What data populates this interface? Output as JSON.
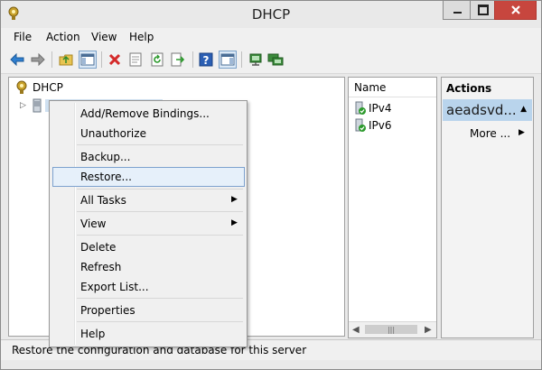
{
  "window": {
    "title": "DHCP",
    "controls": {
      "minimize_icon": "minimize-icon",
      "maximize_icon": "maximize-icon",
      "close_icon": "close-icon"
    }
  },
  "menubar": {
    "items": [
      "File",
      "Action",
      "View",
      "Help"
    ]
  },
  "toolbar": {
    "buttons": [
      "back-arrow-icon",
      "forward-arrow-icon",
      "up-folder-icon",
      "show-hide-tree-icon",
      "delete-icon",
      "properties-icon",
      "refresh-icon",
      "export-icon",
      "help-icon",
      "show-hide-action-pane-icon",
      "server-icon",
      "server-authorize-icon"
    ]
  },
  "tree": {
    "root": {
      "label": "DHCP",
      "icon": "dhcp-icon"
    },
    "server": {
      "icon": "server-icon"
    }
  },
  "list": {
    "column": "Name",
    "items": [
      {
        "label": "IPv4",
        "icon": "ipv4-icon"
      },
      {
        "label": "IPv6",
        "icon": "ipv6-icon"
      }
    ]
  },
  "actions": {
    "header": "Actions",
    "selected": "aeadsvd...",
    "more": "More ..."
  },
  "context_menu": {
    "items": [
      {
        "label": "Add/Remove Bindings..."
      },
      {
        "label": "Unauthorize"
      },
      {
        "label": "Backup..."
      },
      {
        "label": "Restore...",
        "highlighted": true
      },
      {
        "label": "All Tasks",
        "submenu": true
      },
      {
        "label": "View",
        "submenu": true
      },
      {
        "label": "Delete"
      },
      {
        "label": "Refresh"
      },
      {
        "label": "Export List..."
      },
      {
        "label": "Properties"
      },
      {
        "label": "Help"
      }
    ]
  },
  "status": {
    "text": "Restore the configuration and database for this server"
  },
  "colors": {
    "highlight": "#e6f0fa",
    "selection": "#b9d4ec",
    "close": "#c7463e"
  }
}
